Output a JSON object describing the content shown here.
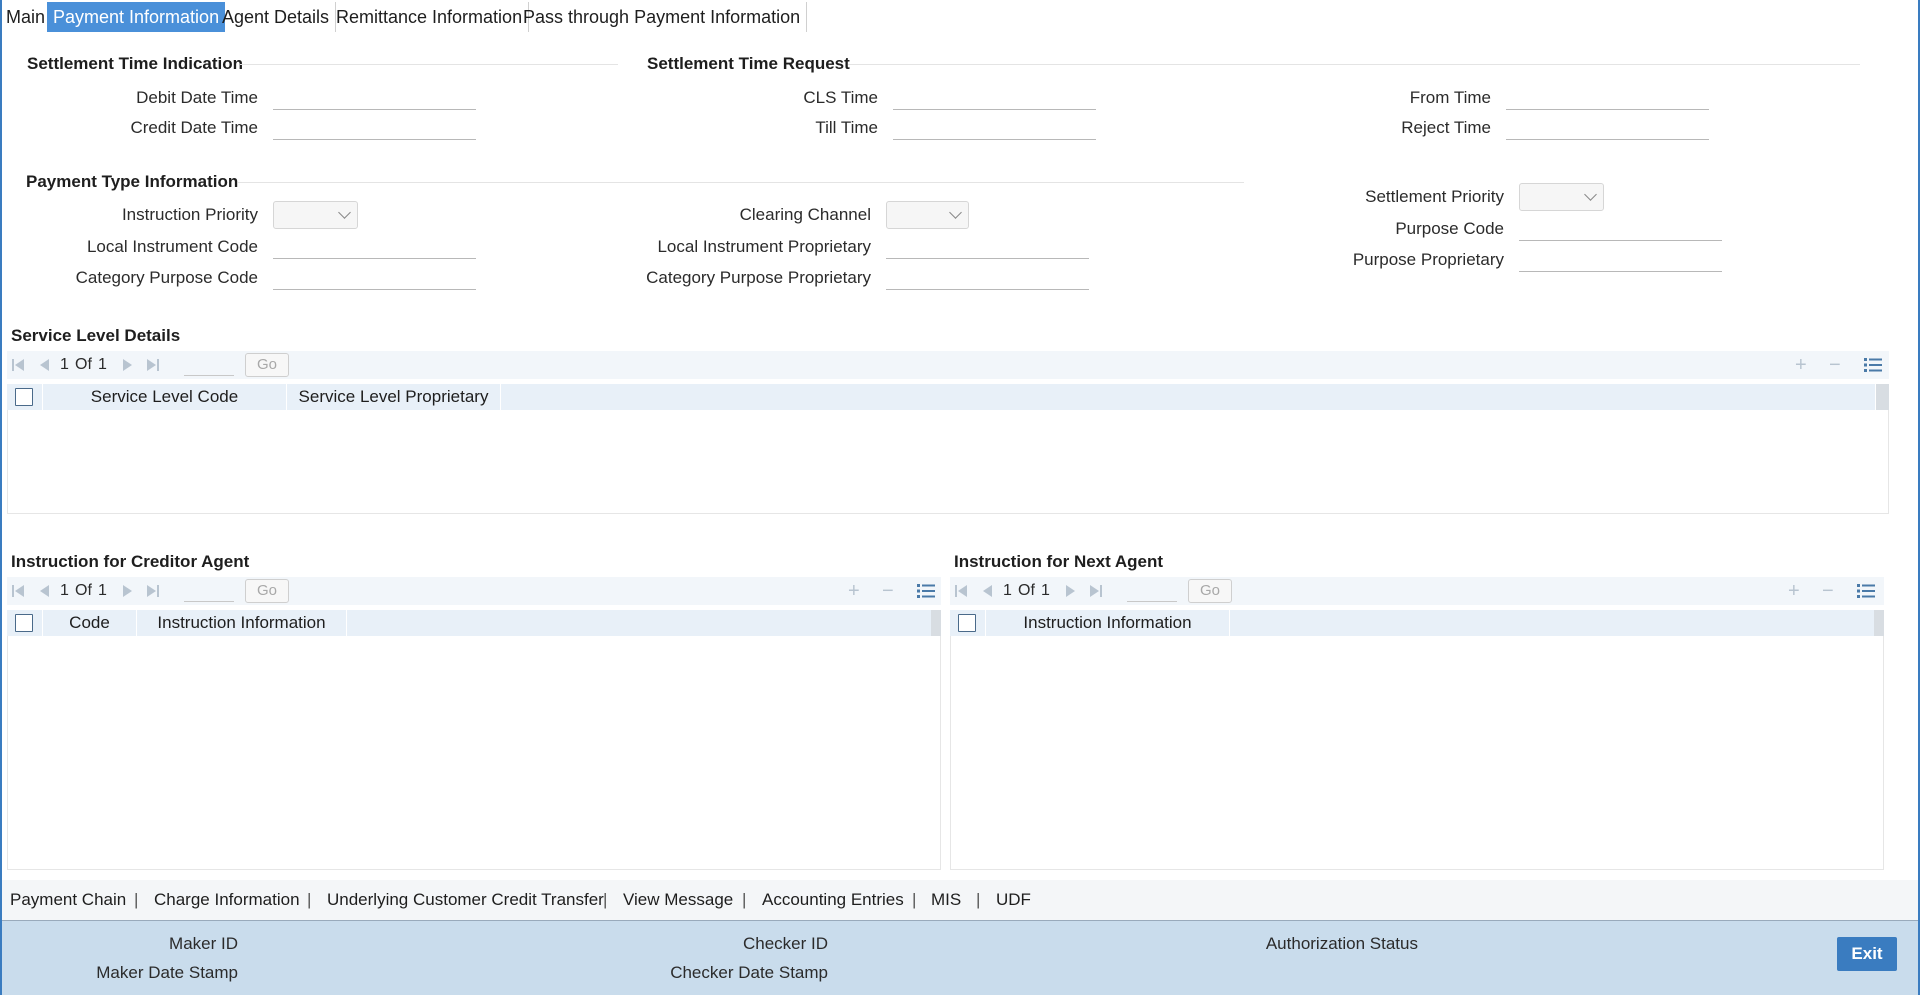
{
  "tabs": [
    "Main",
    "Payment Information",
    "Agent Details",
    "Remittance Information",
    "Pass through Payment Information"
  ],
  "settlement_time_indication": {
    "title": "Settlement Time Indication",
    "debit_date_time_label": "Debit Date Time",
    "credit_date_time_label": "Credit Date Time"
  },
  "settlement_time_request": {
    "title": "Settlement Time Request",
    "cls_time_label": "CLS Time",
    "till_time_label": "Till Time",
    "from_time_label": "From Time",
    "reject_time_label": "Reject Time"
  },
  "payment_type_information": {
    "title": "Payment Type Information",
    "instruction_priority_label": "Instruction Priority",
    "local_instrument_code_label": "Local Instrument Code",
    "category_purpose_code_label": "Category Purpose Code",
    "clearing_channel_label": "Clearing Channel",
    "local_instrument_proprietary_label": "Local Instrument Proprietary",
    "category_purpose_proprietary_label": "Category Purpose Proprietary",
    "settlement_priority_label": "Settlement Priority",
    "purpose_code_label": "Purpose Code",
    "purpose_proprietary_label": "Purpose Proprietary"
  },
  "service_level_details": {
    "title": "Service Level Details",
    "page_current": "1",
    "page_of": "Of",
    "page_total": "1",
    "go_label": "Go",
    "columns": [
      "Service Level Code",
      "Service Level Proprietary"
    ]
  },
  "creditor_agent": {
    "title": "Instruction for Creditor Agent",
    "page_current": "1",
    "page_of": "Of",
    "page_total": "1",
    "go_label": "Go",
    "columns": [
      "Code",
      "Instruction Information"
    ]
  },
  "next_agent": {
    "title": "Instruction for Next Agent",
    "page_current": "1",
    "page_of": "Of",
    "page_total": "1",
    "go_label": "Go",
    "columns": [
      "Instruction Information"
    ]
  },
  "bottom_links": [
    "Payment Chain",
    "Charge Information",
    "Underlying Customer Credit Transfer",
    "View Message",
    "Accounting Entries",
    "MIS",
    "UDF"
  ],
  "link_separator": "|",
  "footer": {
    "maker_id_label": "Maker ID",
    "maker_date_stamp_label": "Maker Date Stamp",
    "checker_id_label": "Checker ID",
    "checker_date_stamp_label": "Checker Date Stamp",
    "authorization_status_label": "Authorization Status",
    "exit_label": "Exit"
  },
  "colors": {
    "accent": "#4a90d9",
    "footer_bg": "#c9dcec",
    "grid_header_bg": "#e8f0f8",
    "exit_button": "#3a7cc0"
  }
}
